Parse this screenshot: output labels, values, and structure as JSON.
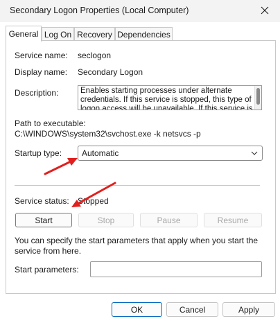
{
  "window": {
    "title": "Secondary Logon Properties (Local Computer)"
  },
  "tabs": [
    {
      "label": "General"
    },
    {
      "label": "Log On"
    },
    {
      "label": "Recovery"
    },
    {
      "label": "Dependencies"
    }
  ],
  "general": {
    "service_name_label": "Service name:",
    "service_name_value": "seclogon",
    "display_name_label": "Display name:",
    "display_name_value": "Secondary Logon",
    "description_label": "Description:",
    "description_value": "Enables starting processes under alternate credentials. If this service is stopped, this type of logon access will be unavailable. If this service is",
    "path_label": "Path to executable:",
    "path_value": "C:\\WINDOWS\\system32\\svchost.exe -k netsvcs -p",
    "startup_type_label": "Startup type:",
    "startup_type_value": "Automatic",
    "service_status_label": "Service status:",
    "service_status_value": "Stopped",
    "start_label": "Start",
    "stop_label": "Stop",
    "pause_label": "Pause",
    "resume_label": "Resume",
    "hint_text": "You can specify the start parameters that apply when you start the service from here.",
    "start_params_label": "Start parameters:",
    "start_params_value": ""
  },
  "footer": {
    "ok_label": "OK",
    "cancel_label": "Cancel",
    "apply_label": "Apply"
  },
  "annotations": {
    "arrow_color": "#e0201e"
  }
}
